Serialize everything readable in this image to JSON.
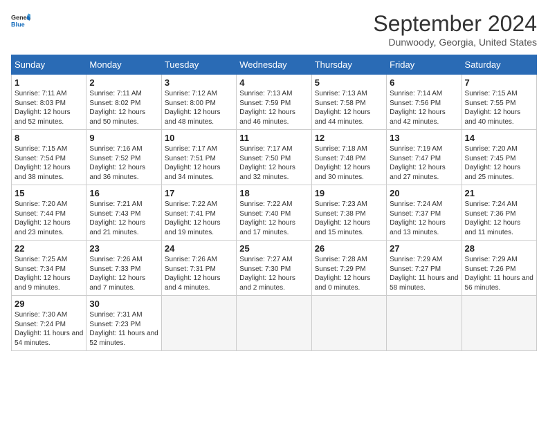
{
  "header": {
    "logo_general": "General",
    "logo_blue": "Blue",
    "title": "September 2024",
    "location": "Dunwoody, Georgia, United States"
  },
  "calendar": {
    "days_of_week": [
      "Sunday",
      "Monday",
      "Tuesday",
      "Wednesday",
      "Thursday",
      "Friday",
      "Saturday"
    ],
    "weeks": [
      [
        {
          "day": "",
          "empty": true
        },
        {
          "day": "",
          "empty": true
        },
        {
          "day": "",
          "empty": true
        },
        {
          "day": "",
          "empty": true
        },
        {
          "day": "",
          "empty": true
        },
        {
          "day": "",
          "empty": true
        },
        {
          "day": "",
          "empty": true
        }
      ]
    ],
    "cells": [
      {
        "date": null,
        "empty": true
      },
      {
        "date": null,
        "empty": true
      },
      {
        "date": null,
        "empty": true
      },
      {
        "date": null,
        "empty": true
      },
      {
        "date": null,
        "empty": true
      },
      {
        "date": null,
        "empty": true
      },
      {
        "date": null,
        "empty": true
      },
      {
        "num": "1",
        "sunrise": "7:11 AM",
        "sunset": "8:03 PM",
        "daylight": "12 hours and 52 minutes."
      },
      {
        "num": "2",
        "sunrise": "7:11 AM",
        "sunset": "8:02 PM",
        "daylight": "12 hours and 50 minutes."
      },
      {
        "num": "3",
        "sunrise": "7:12 AM",
        "sunset": "8:00 PM",
        "daylight": "12 hours and 48 minutes."
      },
      {
        "num": "4",
        "sunrise": "7:13 AM",
        "sunset": "7:59 PM",
        "daylight": "12 hours and 46 minutes."
      },
      {
        "num": "5",
        "sunrise": "7:13 AM",
        "sunset": "7:58 PM",
        "daylight": "12 hours and 44 minutes."
      },
      {
        "num": "6",
        "sunrise": "7:14 AM",
        "sunset": "7:56 PM",
        "daylight": "12 hours and 42 minutes."
      },
      {
        "num": "7",
        "sunrise": "7:15 AM",
        "sunset": "7:55 PM",
        "daylight": "12 hours and 40 minutes."
      },
      {
        "num": "8",
        "sunrise": "7:15 AM",
        "sunset": "7:54 PM",
        "daylight": "12 hours and 38 minutes."
      },
      {
        "num": "9",
        "sunrise": "7:16 AM",
        "sunset": "7:52 PM",
        "daylight": "12 hours and 36 minutes."
      },
      {
        "num": "10",
        "sunrise": "7:17 AM",
        "sunset": "7:51 PM",
        "daylight": "12 hours and 34 minutes."
      },
      {
        "num": "11",
        "sunrise": "7:17 AM",
        "sunset": "7:50 PM",
        "daylight": "12 hours and 32 minutes."
      },
      {
        "num": "12",
        "sunrise": "7:18 AM",
        "sunset": "7:48 PM",
        "daylight": "12 hours and 30 minutes."
      },
      {
        "num": "13",
        "sunrise": "7:19 AM",
        "sunset": "7:47 PM",
        "daylight": "12 hours and 27 minutes."
      },
      {
        "num": "14",
        "sunrise": "7:20 AM",
        "sunset": "7:45 PM",
        "daylight": "12 hours and 25 minutes."
      },
      {
        "num": "15",
        "sunrise": "7:20 AM",
        "sunset": "7:44 PM",
        "daylight": "12 hours and 23 minutes."
      },
      {
        "num": "16",
        "sunrise": "7:21 AM",
        "sunset": "7:43 PM",
        "daylight": "12 hours and 21 minutes."
      },
      {
        "num": "17",
        "sunrise": "7:22 AM",
        "sunset": "7:41 PM",
        "daylight": "12 hours and 19 minutes."
      },
      {
        "num": "18",
        "sunrise": "7:22 AM",
        "sunset": "7:40 PM",
        "daylight": "12 hours and 17 minutes."
      },
      {
        "num": "19",
        "sunrise": "7:23 AM",
        "sunset": "7:38 PM",
        "daylight": "12 hours and 15 minutes."
      },
      {
        "num": "20",
        "sunrise": "7:24 AM",
        "sunset": "7:37 PM",
        "daylight": "12 hours and 13 minutes."
      },
      {
        "num": "21",
        "sunrise": "7:24 AM",
        "sunset": "7:36 PM",
        "daylight": "12 hours and 11 minutes."
      },
      {
        "num": "22",
        "sunrise": "7:25 AM",
        "sunset": "7:34 PM",
        "daylight": "12 hours and 9 minutes."
      },
      {
        "num": "23",
        "sunrise": "7:26 AM",
        "sunset": "7:33 PM",
        "daylight": "12 hours and 7 minutes."
      },
      {
        "num": "24",
        "sunrise": "7:26 AM",
        "sunset": "7:31 PM",
        "daylight": "12 hours and 4 minutes."
      },
      {
        "num": "25",
        "sunrise": "7:27 AM",
        "sunset": "7:30 PM",
        "daylight": "12 hours and 2 minutes."
      },
      {
        "num": "26",
        "sunrise": "7:28 AM",
        "sunset": "7:29 PM",
        "daylight": "12 hours and 0 minutes."
      },
      {
        "num": "27",
        "sunrise": "7:29 AM",
        "sunset": "7:27 PM",
        "daylight": "11 hours and 58 minutes."
      },
      {
        "num": "28",
        "sunrise": "7:29 AM",
        "sunset": "7:26 PM",
        "daylight": "11 hours and 56 minutes."
      },
      {
        "num": "29",
        "sunrise": "7:30 AM",
        "sunset": "7:24 PM",
        "daylight": "11 hours and 54 minutes."
      },
      {
        "num": "30",
        "sunrise": "7:31 AM",
        "sunset": "7:23 PM",
        "daylight": "11 hours and 52 minutes."
      },
      {
        "date": null,
        "empty": true
      },
      {
        "date": null,
        "empty": true
      },
      {
        "date": null,
        "empty": true
      },
      {
        "date": null,
        "empty": true
      },
      {
        "date": null,
        "empty": true
      }
    ]
  }
}
